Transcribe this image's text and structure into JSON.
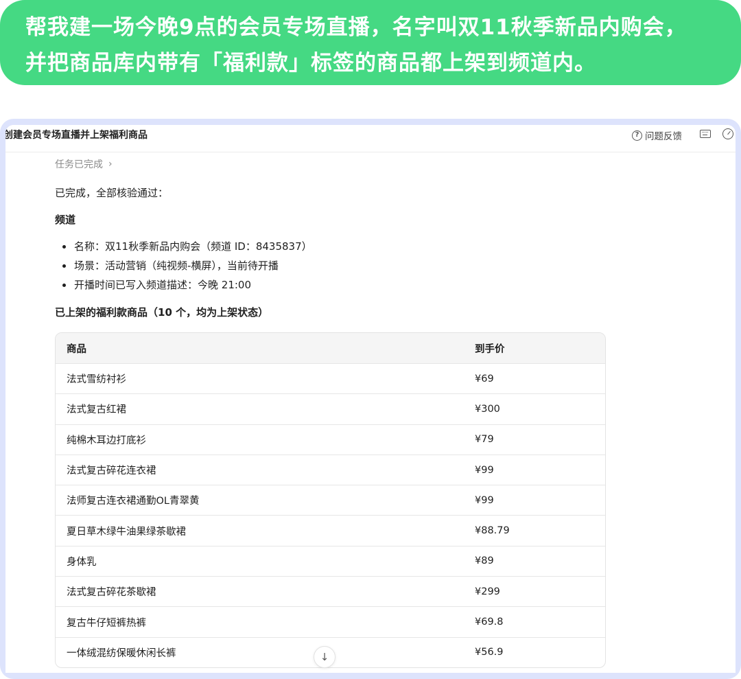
{
  "prompt": {
    "line1": "帮我建一场今晚9点的会员专场直播，名字叫双11秋季新品内购会，",
    "line2": "并把商品库内带有「福利款」标签的商品都上架到频道内。",
    "bg_color": "#45d983"
  },
  "window": {
    "title": "创建会员专场直播并上架福利商品",
    "feedback_label": "问题反馈",
    "icons": [
      "help-circle-icon",
      "keyboard-icon",
      "gauge-icon"
    ]
  },
  "content": {
    "task_status": "任务已完成",
    "summary": "已完成，全部核验通过：",
    "channel_heading": "频道",
    "channel_items": [
      "名称：双11秋季新品内购会（频道 ID：8435837）",
      "场景：活动营销（纯视频-横屏），当前待开播",
      "开播时间已写入频道描述：今晚 21:00"
    ],
    "products_heading": "已上架的福利款商品（10 个，均为上架状态）",
    "table": {
      "headers": [
        "商品",
        "到手价"
      ],
      "rows": [
        [
          "法式雪纺衬衫",
          "¥69"
        ],
        [
          "法式复古红裙",
          "¥300"
        ],
        [
          "纯棉木耳边打底衫",
          "¥79"
        ],
        [
          "法式复古碎花连衣裙",
          "¥99"
        ],
        [
          "法师复古连衣裙通勤OL青翠黄",
          "¥99"
        ],
        [
          "夏日草木绿牛油果绿茶歇裙",
          "¥88.79"
        ],
        [
          "身体乳",
          "¥89"
        ],
        [
          "法式复古碎花茶歇裙",
          "¥299"
        ],
        [
          "复古牛仔短裤热裤",
          "¥69.8"
        ],
        [
          "一体绒混纺保暖休闲长裤",
          "¥56.9"
        ]
      ]
    }
  }
}
